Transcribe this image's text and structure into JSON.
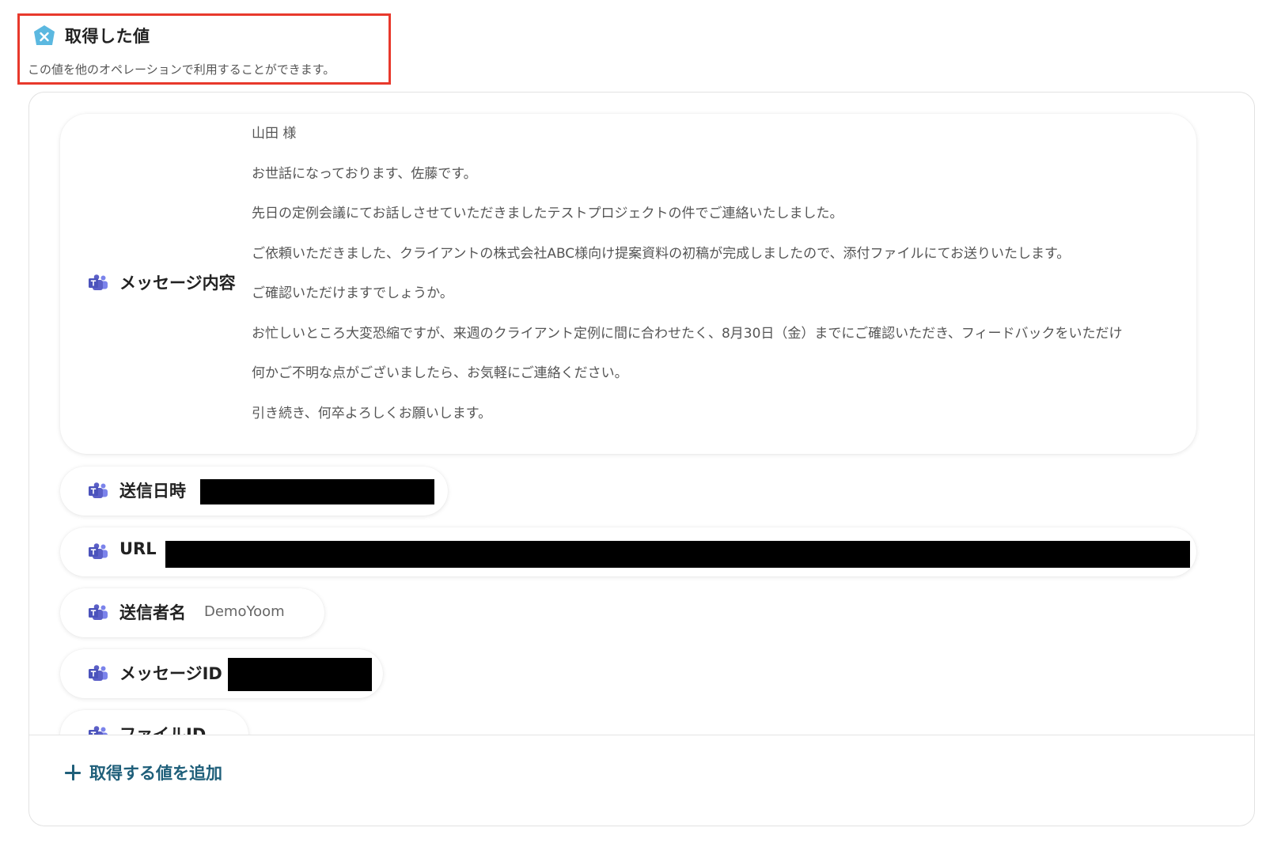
{
  "header": {
    "title": "取得した値",
    "subtitle": "この値を他のオペレーションで利用することができます。",
    "highlight_color": "#e8392c",
    "logo_color": "#5bb8e0"
  },
  "fields": {
    "message": {
      "label": "メッセージ内容",
      "lines": [
        "山田 様",
        "お世話になっております、佐藤です。",
        "先日の定例会議にてお話しさせていただきましたテストプロジェクトの件でご連絡いたしました。",
        "ご依頼いただきました、クライアントの株式会社ABC様向け提案資料の初稿が完成しましたので、添付ファイルにてお送りいたします。",
        "ご確認いただけますでしょうか。",
        "お忙しいところ大変恐縮ですが、来週のクライアント定例に間に合わせたく、8月30日（金）までにご確認いただき、フィードバックをいただけ",
        "何かご不明な点がございましたら、お気軽にご連絡ください。",
        "引き続き、何卒よろしくお願いします。"
      ]
    },
    "sent_at": {
      "label": "送信日時",
      "value_redacted": true
    },
    "url": {
      "label": "URL",
      "value_redacted": true
    },
    "sender_name": {
      "label": "送信者名",
      "value": "DemoYoom"
    },
    "message_id": {
      "label": "メッセージID",
      "value_redacted": true
    },
    "file_id": {
      "label": "ファイルID"
    }
  },
  "add_value": {
    "label": "取得する値を追加",
    "color": "#1f5f7a"
  },
  "icons": {
    "field_icon": "microsoft-teams-icon",
    "teams_color": "#5b5fc7",
    "header_icon": "yoom-logo-icon",
    "add_icon": "plus-icon"
  }
}
